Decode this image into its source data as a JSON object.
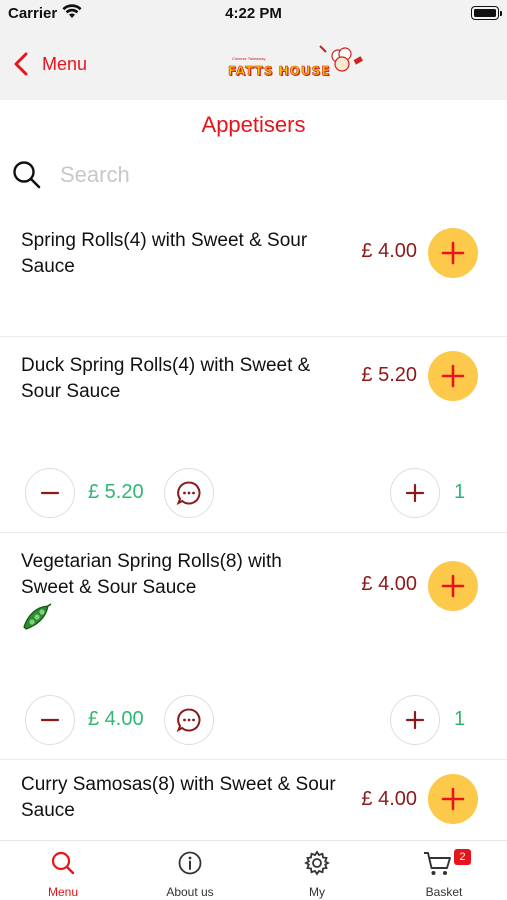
{
  "status_bar": {
    "carrier": "Carrier",
    "time": "4:22 PM"
  },
  "nav": {
    "back_label": "Menu",
    "logo_text": "FATTS HOUSE",
    "logo_subtitle": "Chinese Takeaway"
  },
  "section_title": "Appetisers",
  "search": {
    "placeholder": "Search",
    "value": ""
  },
  "items": [
    {
      "name": "Spring Rolls(4) with Sweet & Sour Sauce",
      "price": "£ 4.00"
    },
    {
      "name": "Duck Spring Rolls(4) with Sweet & Sour Sauce",
      "price": "£ 5.20",
      "line_price": "£ 5.20",
      "quantity": "1"
    },
    {
      "name": "Vegetarian Spring Rolls(8) with Sweet & Sour Sauce",
      "price": "£ 4.00",
      "vegetarian_icon": "pea-pod-icon",
      "line_price": "£ 4.00",
      "quantity": "1"
    },
    {
      "name": "Curry Samosas(8) with Sweet & Sour Sauce",
      "price": "£ 4.00"
    }
  ],
  "tabs": [
    {
      "label": "Menu",
      "icon": "search-icon",
      "active": true
    },
    {
      "label": "About us",
      "icon": "info-icon"
    },
    {
      "label": "My",
      "icon": "gear-icon"
    },
    {
      "label": "Basket",
      "icon": "cart-icon",
      "badge": "2"
    }
  ],
  "colors": {
    "accent_red": "#e8141b",
    "price": "#8b1a1a",
    "add_button": "#fdc94a",
    "quantity_green": "#2eb872",
    "bar_background": "#f2f2f2"
  }
}
